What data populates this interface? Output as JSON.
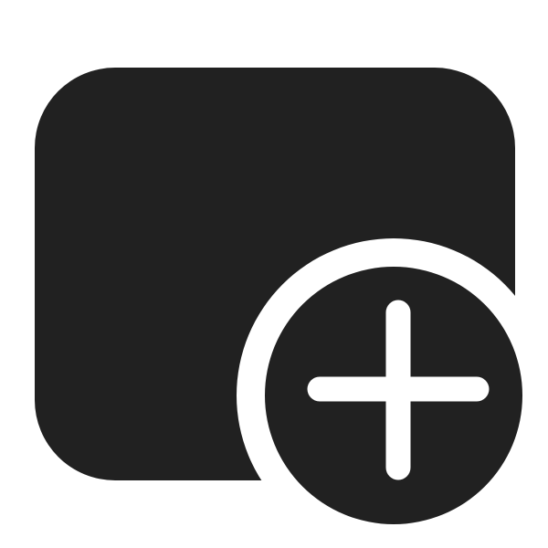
{
  "icon": {
    "name": "add-tab-icon",
    "color": "#212121",
    "background": "#ffffff",
    "badge_glyph": "plus"
  }
}
